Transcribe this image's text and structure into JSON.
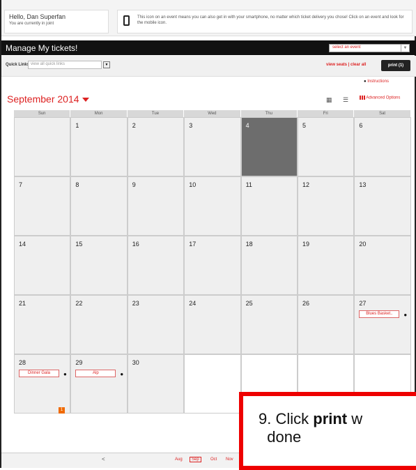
{
  "greeting": {
    "name": "Hello, Dan Superfan",
    "status": "You are currently in joint"
  },
  "mobile_info": "This icon on an event means you can also get in with your smartphone, no matter which ticket delivery you chose! Click on an event and look for the mobile icon.",
  "header": {
    "title": "Manage My tickets!",
    "event_select": "select an event"
  },
  "quick_links": {
    "label": "Quick Links",
    "placeholder": "view all quick links",
    "view_seats": "view seats | clear all",
    "print": "print (1)"
  },
  "instructions": "Instructions",
  "calendar": {
    "month": "September 2014",
    "advanced": "Advanced Options",
    "days": [
      "Sun",
      "Mon",
      "Tue",
      "Wed",
      "Thu",
      "Fri",
      "Sat"
    ],
    "weeks": [
      [
        "",
        "1",
        "2",
        "3",
        "4",
        "5",
        "6"
      ],
      [
        "7",
        "8",
        "9",
        "10",
        "11",
        "12",
        "13"
      ],
      [
        "14",
        "15",
        "16",
        "17",
        "18",
        "19",
        "20"
      ],
      [
        "21",
        "22",
        "23",
        "24",
        "25",
        "26",
        "27"
      ],
      [
        "28",
        "29",
        "30",
        "",
        "",
        "",
        ""
      ]
    ],
    "today": "4",
    "events": {
      "e27": "Blues Basket..",
      "e28": "Dinner Gala",
      "e29": "Alp"
    },
    "badge": "1"
  },
  "footer": {
    "prev": "<",
    "months": [
      "Aug",
      "Sep",
      "Oct",
      "Nov"
    ],
    "active": "Sep"
  },
  "callout": {
    "step": "9. Click ",
    "bold": "print",
    "rest": " w",
    "line2": "done"
  }
}
